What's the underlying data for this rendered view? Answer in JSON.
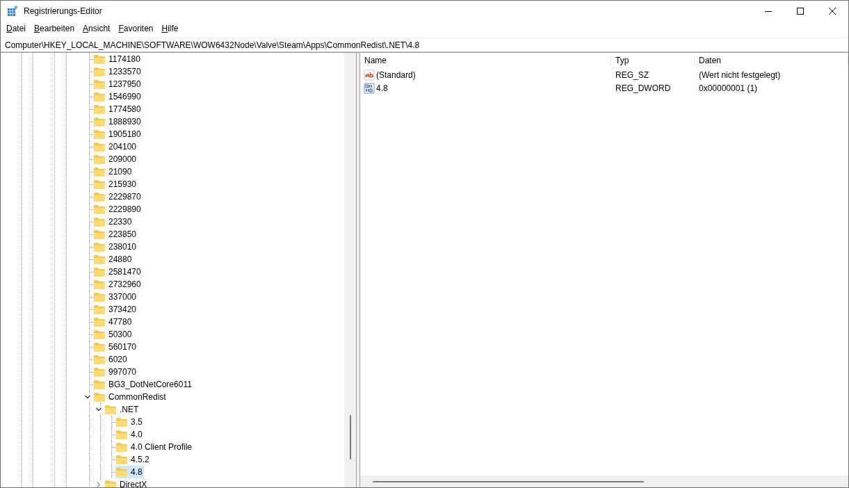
{
  "window": {
    "title": "Registrierungs-Editor"
  },
  "menu": [
    "Datei",
    "Bearbeiten",
    "Ansicht",
    "Favoriten",
    "Hilfe"
  ],
  "address": "Computer\\HKEY_LOCAL_MACHINE\\SOFTWARE\\WOW6432Node\\Valve\\Steam\\Apps\\CommonRedist\\.NET\\4.8",
  "tree": {
    "items": [
      {
        "label": "1174180",
        "selected": false
      },
      {
        "label": "1233570",
        "selected": false
      },
      {
        "label": "1237950",
        "selected": false
      },
      {
        "label": "1546990",
        "selected": false
      },
      {
        "label": "1774580",
        "selected": false
      },
      {
        "label": "1888930",
        "selected": false
      },
      {
        "label": "1905180",
        "selected": false
      },
      {
        "label": "204100",
        "selected": false
      },
      {
        "label": "209000",
        "selected": false
      },
      {
        "label": "21090",
        "selected": false
      },
      {
        "label": "215930",
        "selected": false
      },
      {
        "label": "2229870",
        "selected": false
      },
      {
        "label": "2229890",
        "selected": false
      },
      {
        "label": "22330",
        "selected": false
      },
      {
        "label": "223850",
        "selected": false
      },
      {
        "label": "238010",
        "selected": false
      },
      {
        "label": "24880",
        "selected": false
      },
      {
        "label": "2581470",
        "selected": false
      },
      {
        "label": "2732960",
        "selected": false
      },
      {
        "label": "337000",
        "selected": false
      },
      {
        "label": "373420",
        "selected": false
      },
      {
        "label": "47780",
        "selected": false
      },
      {
        "label": "50300",
        "selected": false
      },
      {
        "label": "560170",
        "selected": false
      },
      {
        "label": "6020",
        "selected": false
      },
      {
        "label": "997070",
        "selected": false
      },
      {
        "label": "BG3_DotNetCore6011",
        "selected": false
      },
      {
        "label": "CommonRedist",
        "expanded": true,
        "selected": false,
        "children": [
          {
            "label": ".NET",
            "expanded": true,
            "selected": false,
            "children": [
              {
                "label": "3.5",
                "selected": false
              },
              {
                "label": "4.0",
                "selected": false
              },
              {
                "label": "4.0 Client Profile",
                "selected": false
              },
              {
                "label": "4.5.2",
                "selected": false
              },
              {
                "label": "4.8",
                "selected": true
              }
            ]
          },
          {
            "label": "DirectX",
            "expanded": false,
            "selected": false
          }
        ]
      }
    ]
  },
  "values": {
    "columns": [
      "Name",
      "Typ",
      "Daten"
    ],
    "rows": [
      {
        "kind": "string",
        "name": "(Standard)",
        "type": "REG_SZ",
        "data": "(Wert nicht festgelegt)"
      },
      {
        "kind": "binary",
        "name": "4.8",
        "type": "REG_DWORD",
        "data": "0x00000001 (1)"
      }
    ]
  }
}
